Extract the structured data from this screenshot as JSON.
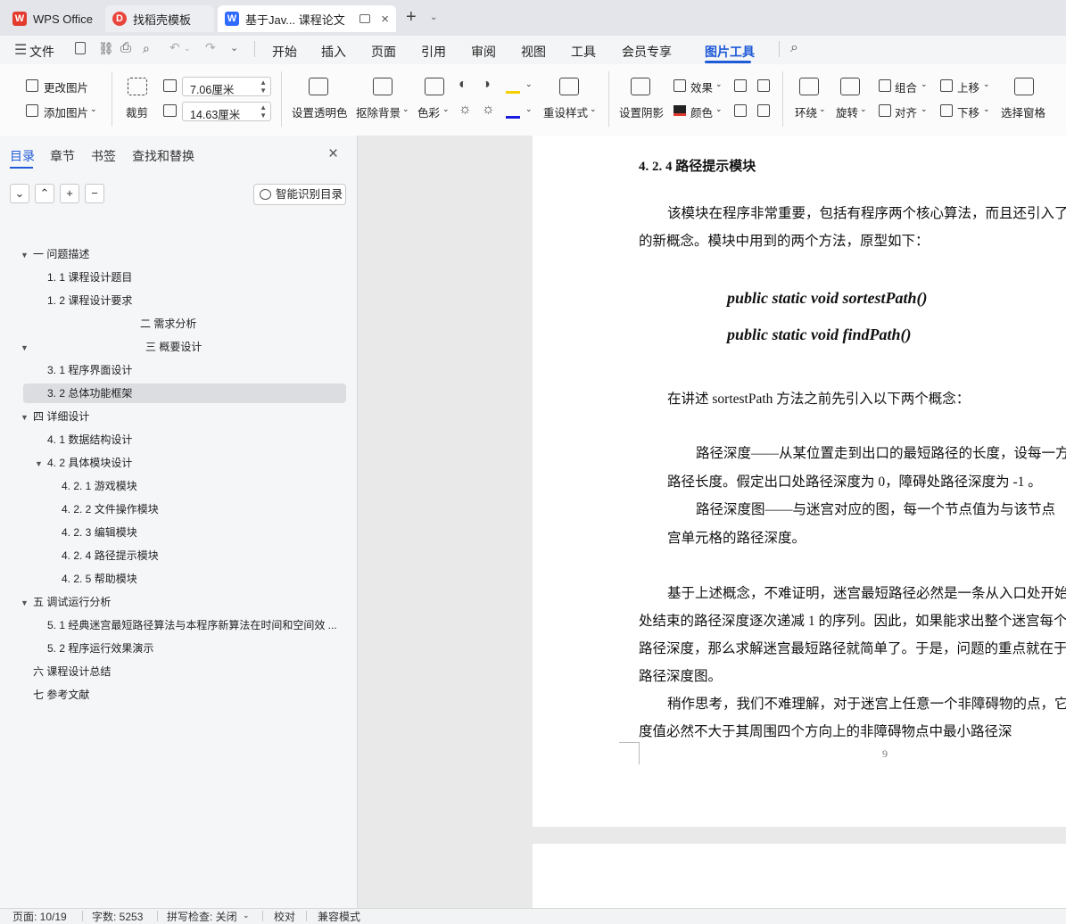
{
  "tabs": [
    {
      "label": "WPS Office"
    },
    {
      "label": "找稻壳模板"
    },
    {
      "label": "基于Jav... 课程论文"
    }
  ],
  "menu": {
    "file": "文件",
    "items": [
      "开始",
      "插入",
      "页面",
      "引用",
      "审阅",
      "视图",
      "工具",
      "会员专享",
      "图片工具"
    ],
    "active": "图片工具"
  },
  "ribbon": {
    "change_image": "更改图片",
    "add_image": "添加图片",
    "crop": "裁剪",
    "width_value": "7.06厘米",
    "height_value": "14.63厘米",
    "set_transparent": "设置透明色",
    "remove_bg": "抠除背景",
    "color_mode": "色彩",
    "reset_style": "重设样式",
    "set_shadow": "设置阴影",
    "effects": "效果",
    "color": "颜色",
    "wrap": "环绕",
    "rotate": "旋转",
    "group": "组合",
    "align": "对齐",
    "bring_forward": "上移",
    "send_backward": "下移",
    "selection_pane": "选择窗格"
  },
  "panel": {
    "tabs": [
      "目录",
      "章节",
      "书签",
      "查找和替换"
    ],
    "smart_toc": "智能识别目录",
    "toc": [
      {
        "text": "一  问题描述"
      },
      {
        "text": "1. 1  课程设计题目"
      },
      {
        "text": "1. 2  课程设计要求"
      },
      {
        "text": "二  需求分析"
      },
      {
        "text": "三  概要设计"
      },
      {
        "text": "3. 1  程序界面设计"
      },
      {
        "text": "3. 2  总体功能框架"
      },
      {
        "text": "四  详细设计"
      },
      {
        "text": "4. 1  数据结构设计"
      },
      {
        "text": "4. 2  具体模块设计"
      },
      {
        "text": "4. 2. 1    游戏模块"
      },
      {
        "text": "4. 2. 2    文件操作模块"
      },
      {
        "text": "4. 2. 3    编辑模块"
      },
      {
        "text": "4. 2. 4    路径提示模块"
      },
      {
        "text": "4. 2. 5    帮助模块"
      },
      {
        "text": "五  调试运行分析"
      },
      {
        "text": "5. 1 经典迷宫最短路径算法与本程序新算法在时间和空间效 ..."
      },
      {
        "text": "5. 2  程序运行效果演示"
      },
      {
        "text": "六  课程设计总结"
      },
      {
        "text": "七  参考文献"
      }
    ]
  },
  "document": {
    "heading": "4. 2. 4    路径提示模块",
    "p1_line1": "该模块在程序非常重要，包括有程序两个核心算法，而且还引入了",
    "p1_line2": "的新概念。模块中用到的两个方法，原型如下：",
    "code1": "public static void sortestPath()",
    "code2": "public static void findPath()",
    "p2": "在讲述 sortestPath 方法之前先引入以下两个概念：",
    "p3_line1": "路径深度——从某位置走到出口的最短路径的长度，设每一方",
    "p3_line2": "路径长度。假定出口处路径深度为 0，障碍处路径深度为  -1  。",
    "p4_line1": "路径深度图——与迷宫对应的图，每一个节点值为与该节点",
    "p4_line2": "宫单元格的路径深度。",
    "p5_line1": "基于上述概念，不难证明，迷宫最短路径必然是一条从入口处开始",
    "p5_line2": "处结束的路径深度逐次递减 1 的序列。因此，如果能求出整个迷宫每个",
    "p5_line3": "路径深度，那么求解迷宫最短路径就简单了。于是，问题的重点就在于",
    "p5_line4": "路径深度图。",
    "p6_line1": "稍作思考，我们不难理解，对于迷宫上任意一个非障碍物的点，它",
    "p6_line2": "度值必然不大于其周围四个方向上的非障碍物点中最小路径深",
    "page_number": "9"
  },
  "status": {
    "page": "页面: 10/19",
    "words": "字数: 5253",
    "spell": "拼写检查: 关闭",
    "proof": "校对",
    "compat": "兼容模式"
  },
  "colors": {
    "accent": "#1f5bd8",
    "wps_red": "#e23a2f",
    "docer_red": "#e9443c",
    "writer_blue": "#2f6bff"
  }
}
